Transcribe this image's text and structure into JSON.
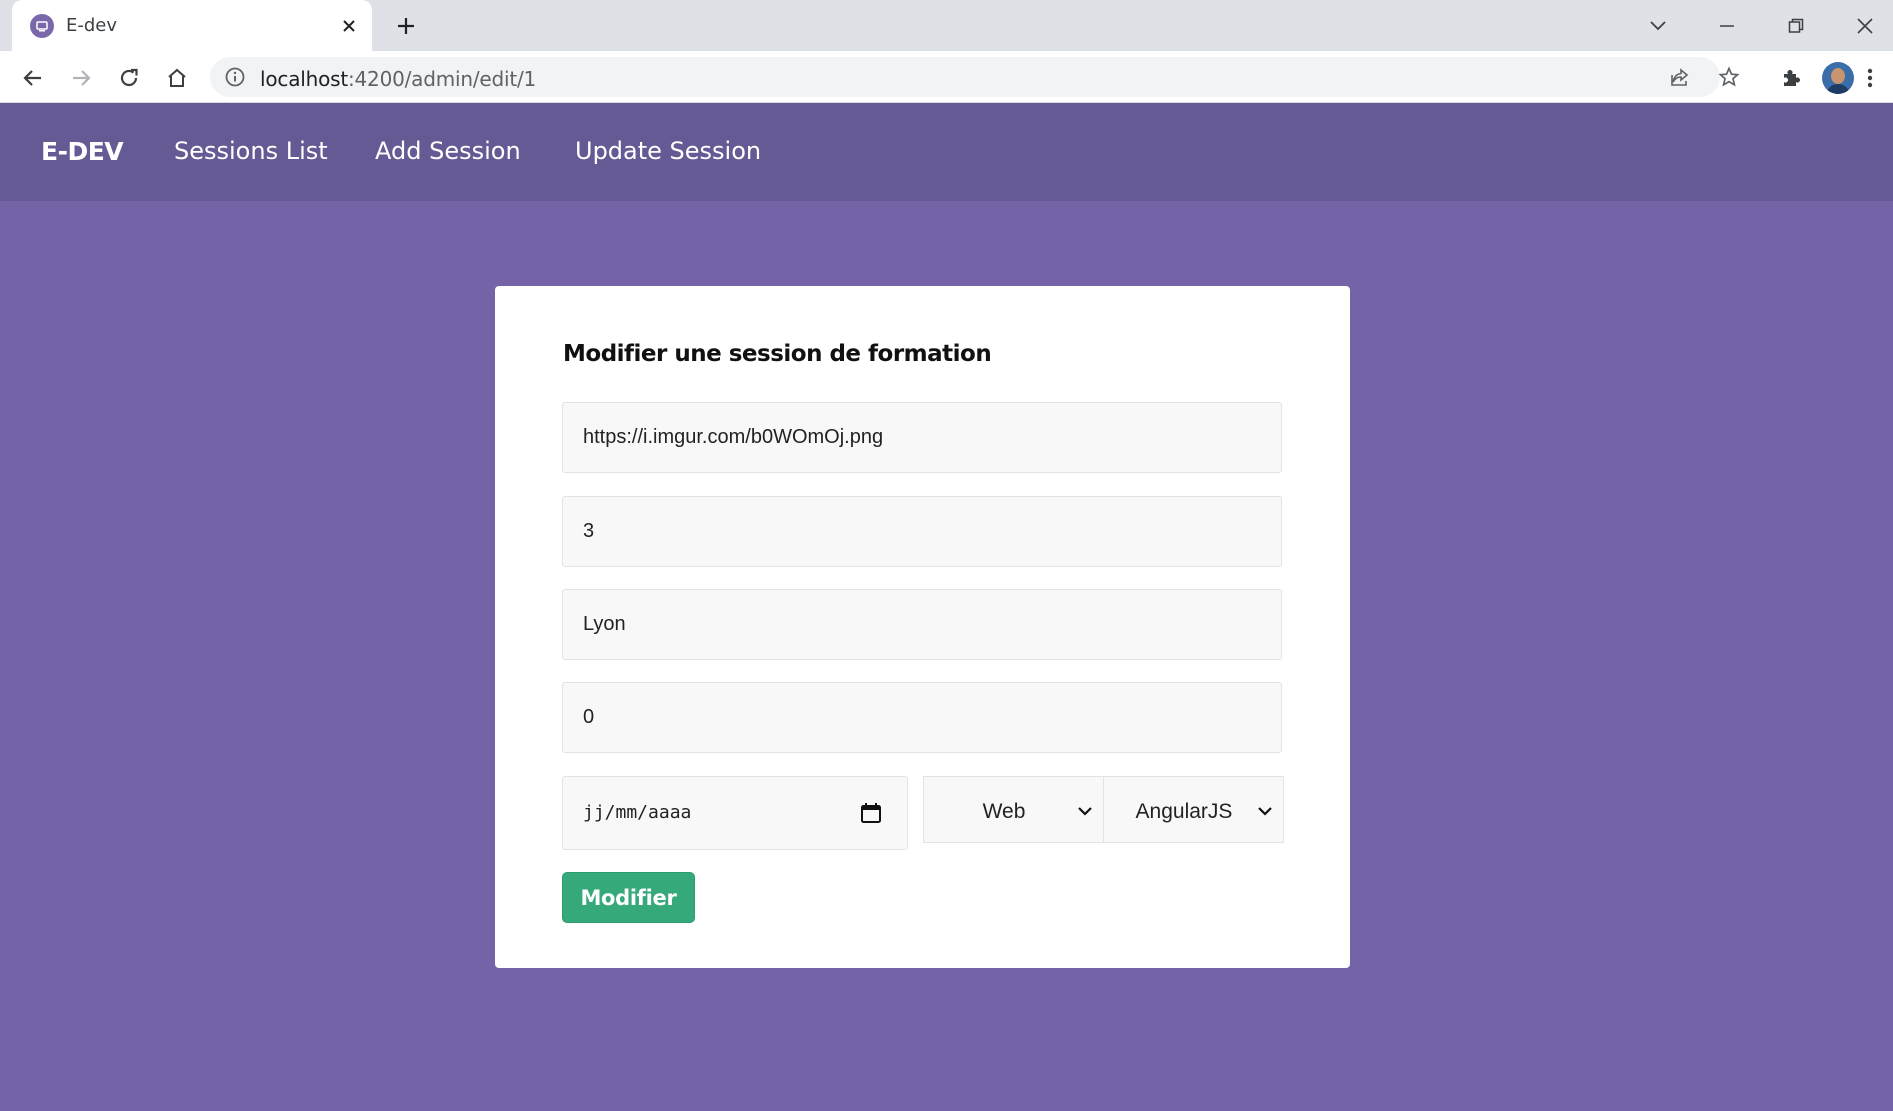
{
  "browser": {
    "tab_title": "E-dev",
    "url_host": "localhost",
    "url_rest": ":4200/admin/edit/1"
  },
  "nav": {
    "brand": "E-DEV",
    "links": [
      "Sessions List",
      "Add Session",
      "Update Session"
    ]
  },
  "form": {
    "title": "Modifier une session de formation",
    "image_url": "https://i.imgur.com/b0WOmOj.png",
    "field2": "3",
    "city": "Lyon",
    "field4": "0",
    "date_placeholder": "jj/mm/aaaa",
    "category": "Web",
    "technology": "AngularJS",
    "submit_label": "Modifier"
  },
  "colors": {
    "page_bg": "#7463a6",
    "navbar_bg": "#665a95",
    "button_bg": "#36a97a"
  }
}
